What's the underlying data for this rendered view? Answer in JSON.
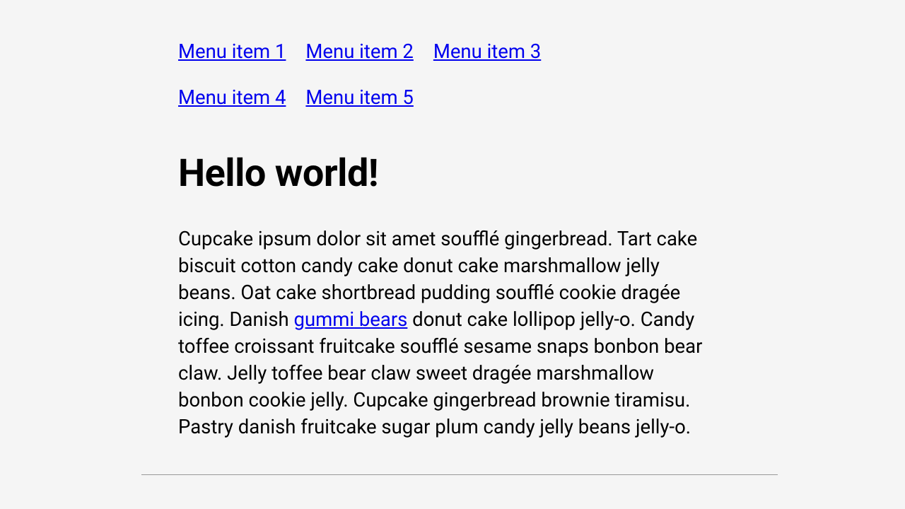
{
  "menu": {
    "items": [
      {
        "label": "Menu item 1"
      },
      {
        "label": "Menu item 2"
      },
      {
        "label": "Menu item 3"
      },
      {
        "label": "Menu item 4"
      },
      {
        "label": "Menu item 5"
      }
    ]
  },
  "heading": "Hello world!",
  "paragraph": {
    "pre": "Cupcake ipsum dolor sit amet soufflé gingerbread. Tart cake biscuit cotton candy cake donut cake marshmallow jelly beans. Oat cake shortbread pudding soufflé cookie dragée icing. Danish ",
    "link_text": "gummi bears",
    "post": " donut cake lollipop jelly-o. Candy toffee croissant fruitcake soufflé sesame snaps bonbon bear claw. Jelly toffee bear claw sweet dragée marshmallow bonbon cookie jelly. Cupcake gingerbread brownie tiramisu. Pastry danish fruitcake sugar plum candy jelly beans jelly-o."
  }
}
